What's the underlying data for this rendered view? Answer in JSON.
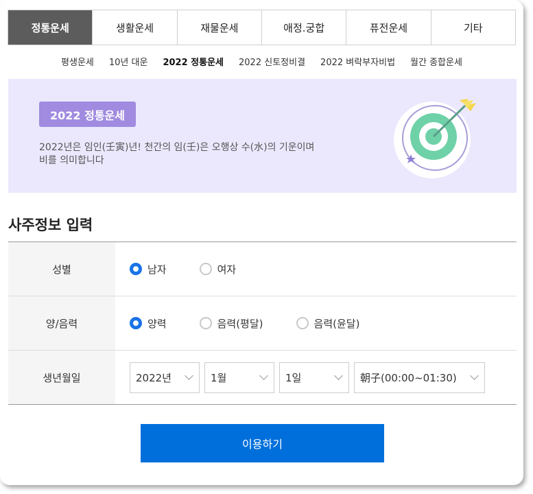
{
  "tabs": [
    "정통운세",
    "생활운세",
    "재물운세",
    "애정.궁합",
    "퓨전운세",
    "기타"
  ],
  "subnav": [
    "평생운세",
    "10년 대운",
    "2022 정통운세",
    "2022 신토정비결",
    "2022 벼락부자비법",
    "월간 종합운세"
  ],
  "banner": {
    "badge": "2022 정통운세",
    "desc_line1": "2022년은 임인(壬寅)년! 천간의 임(壬)은 오행상 수(水)의 기운이며",
    "desc_line2": "비를 의미합니다"
  },
  "form": {
    "title": "사주정보 입력",
    "gender": {
      "label": "성별",
      "options": [
        "남자",
        "여자"
      ],
      "selected": "남자"
    },
    "calendar": {
      "label": "양/음력",
      "options": [
        "양력",
        "음력(평달)",
        "음력(윤달)"
      ],
      "selected": "양력"
    },
    "birth": {
      "label": "생년월일",
      "year": "2022년",
      "month": "1월",
      "day": "1일",
      "hour": "朝子(00:00~01:30)"
    }
  },
  "submit_label": "이용하기",
  "colors": {
    "accent": "#006fdb",
    "badge": "#a08be0",
    "banner_bg": "#ebe8fd",
    "active_tab": "#5c5c5c"
  }
}
